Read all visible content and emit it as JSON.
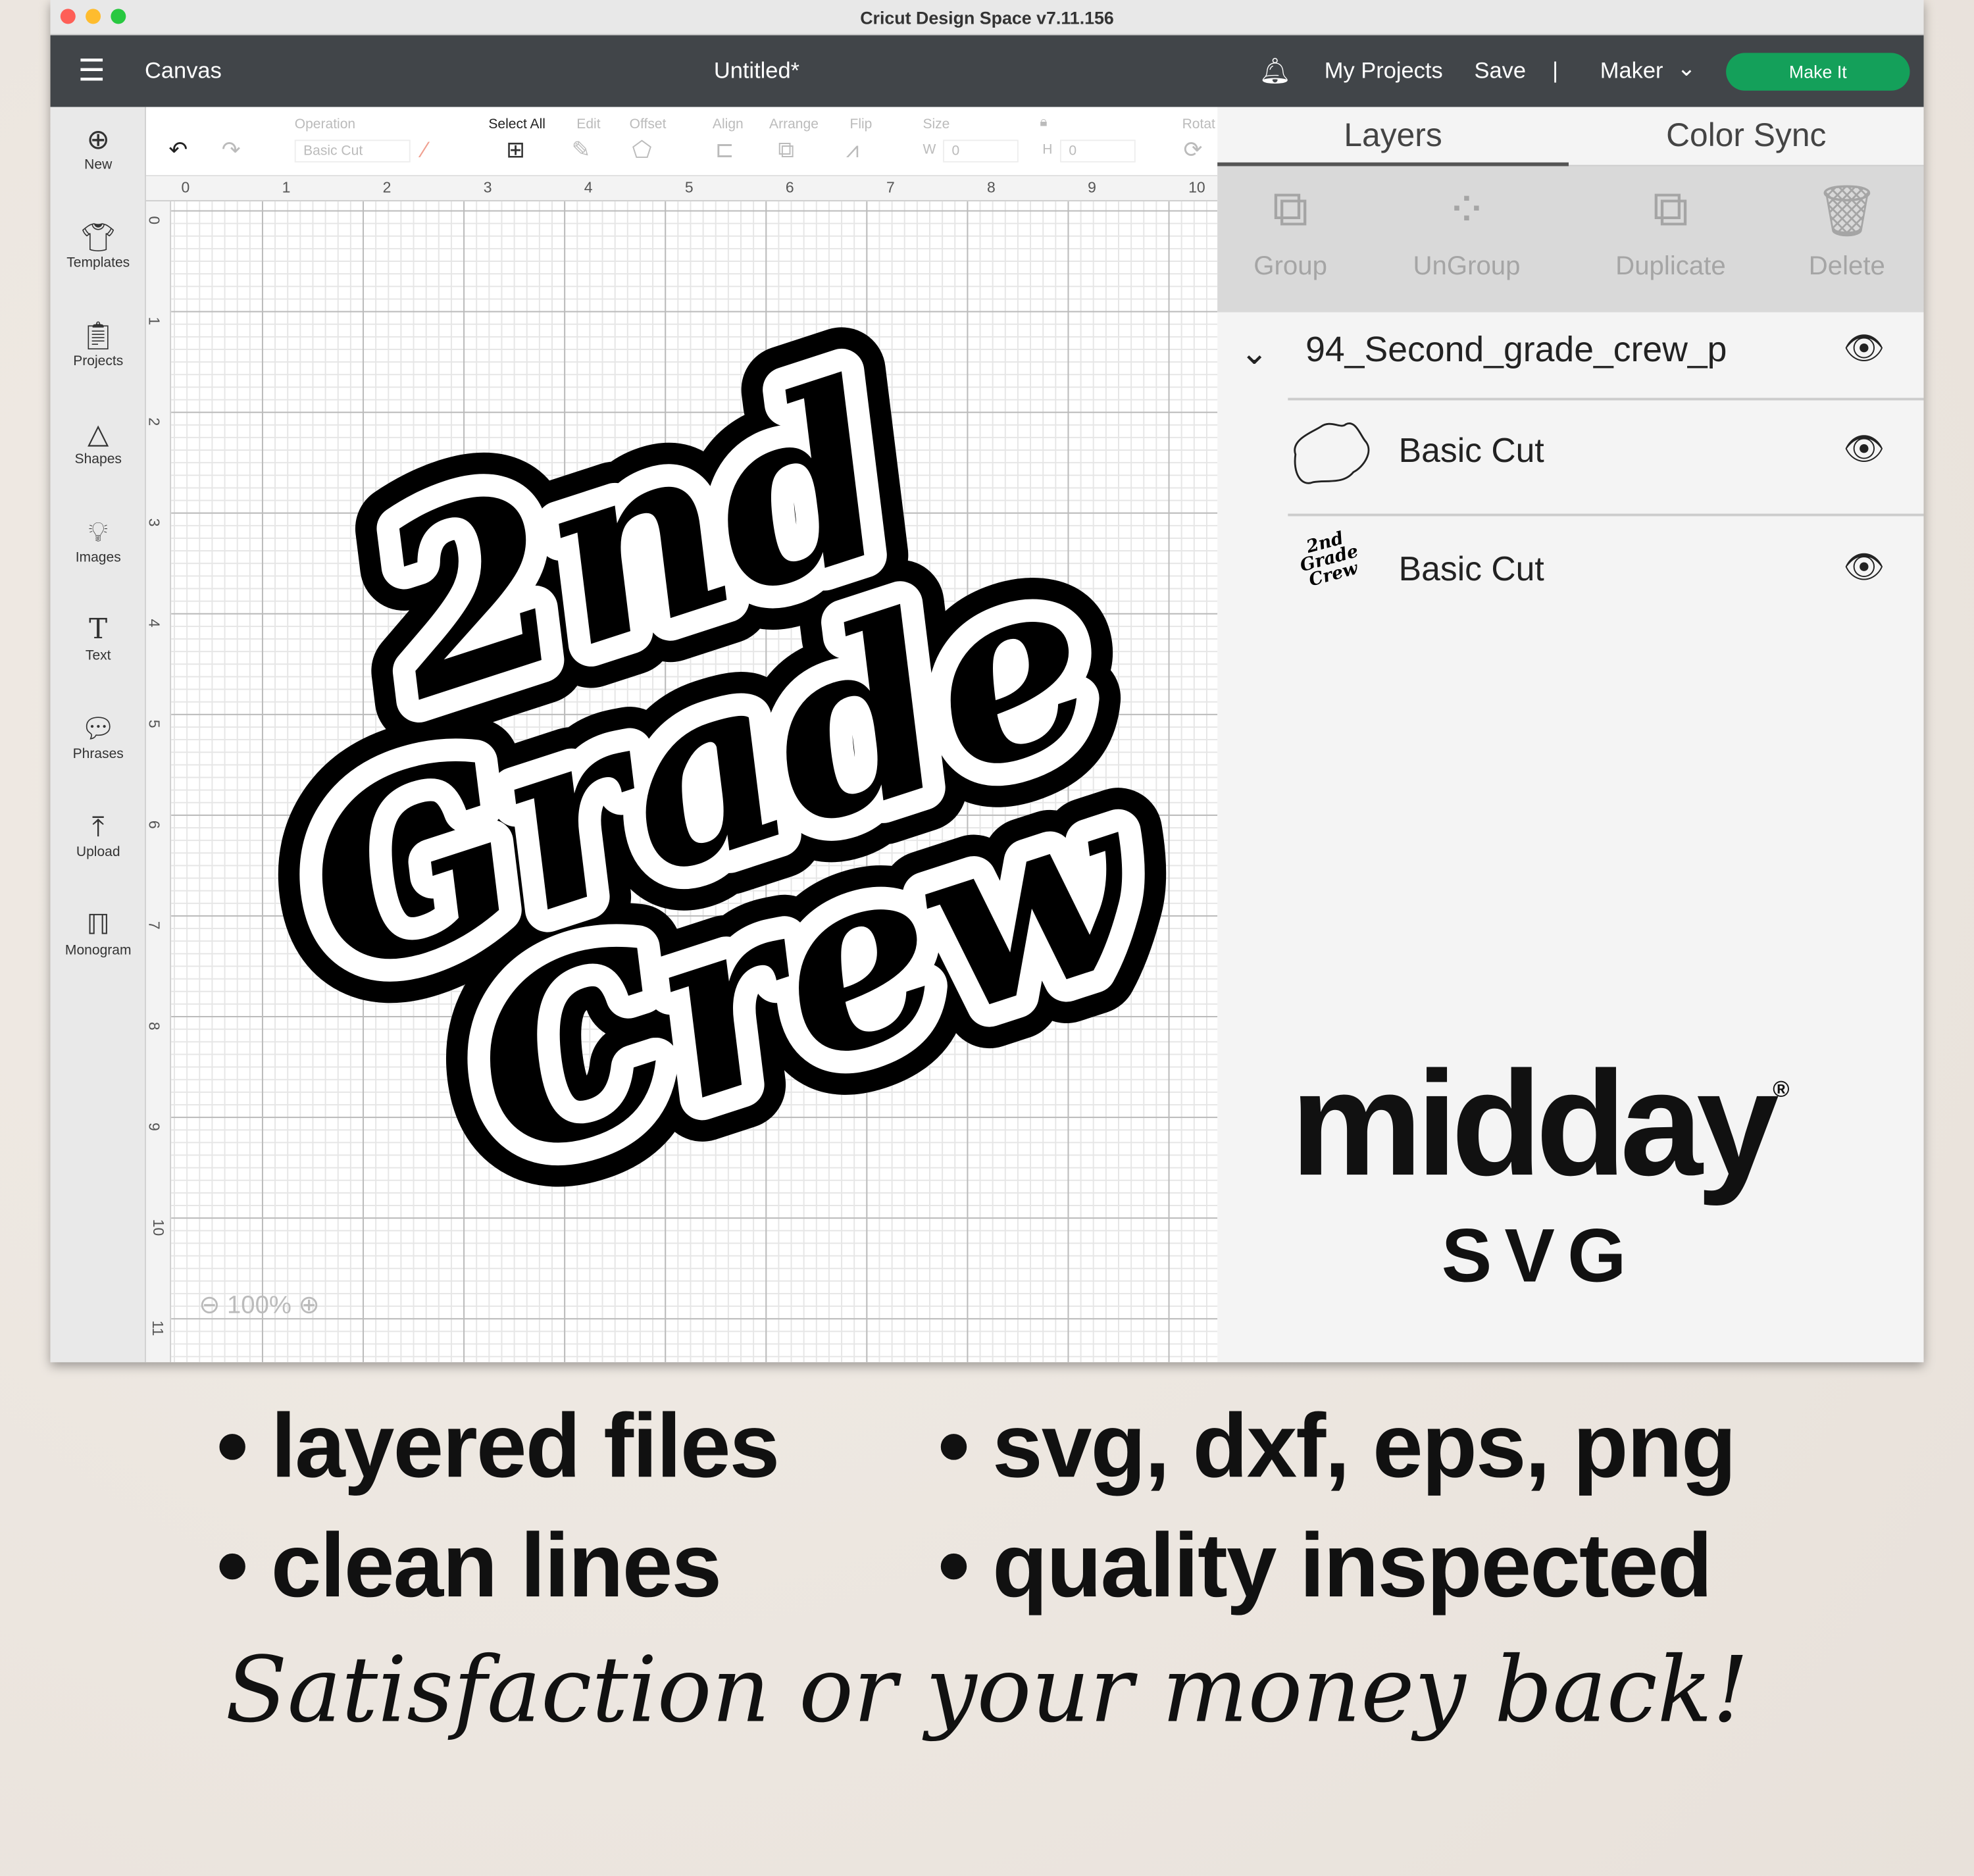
{
  "window": {
    "title": "Cricut Design Space  v7.11.156"
  },
  "header": {
    "menu_icon": "hamburger-icon",
    "canvas_label": "Canvas",
    "doc_title": "Untitled*",
    "bell_icon": "bell-icon",
    "my_projects": "My Projects",
    "save": "Save",
    "separator": "|",
    "machine": "Maker",
    "make_it": "Make It",
    "accent": "#14a05a"
  },
  "sidebar": {
    "items": [
      {
        "label": "New",
        "icon": "plus-circle-icon"
      },
      {
        "label": "Templates",
        "icon": "shirt-icon"
      },
      {
        "label": "Projects",
        "icon": "clipboard-icon"
      },
      {
        "label": "Shapes",
        "icon": "shapes-icon"
      },
      {
        "label": "Images",
        "icon": "lightbulb-icon"
      },
      {
        "label": "Text",
        "icon": "text-icon"
      },
      {
        "label": "Phrases",
        "icon": "speech-bubble-icon"
      },
      {
        "label": "Upload",
        "icon": "upload-icon"
      },
      {
        "label": "Monogram",
        "icon": "monogram-icon"
      }
    ]
  },
  "toolbar": {
    "operation_label": "Operation",
    "operation_value": "Basic Cut",
    "select_all": "Select All",
    "edit": "Edit",
    "offset": "Offset",
    "align": "Align",
    "arrange": "Arrange",
    "flip": "Flip",
    "size": "Size",
    "w_label": "W",
    "w_value": "0",
    "h_label": "H",
    "h_value": "0",
    "rotate": "Rotat"
  },
  "ruler": {
    "h": [
      "0",
      "1",
      "2",
      "3",
      "4",
      "5",
      "6",
      "7",
      "8",
      "9",
      "10"
    ],
    "v": [
      "0",
      "1",
      "2",
      "3",
      "4",
      "5",
      "6",
      "7",
      "8",
      "9",
      "10",
      "11"
    ]
  },
  "canvas": {
    "zoom": "100%",
    "art_lines": [
      "2nd",
      "Grade",
      "Crew"
    ]
  },
  "panel": {
    "tabs": [
      "Layers",
      "Color Sync"
    ],
    "actions": [
      "Group",
      "UnGroup",
      "Duplicate",
      "Delete"
    ],
    "group_name": "94_Second_grade_crew_p",
    "layers": [
      "Basic Cut",
      "Basic Cut"
    ],
    "thumb_text": "2nd Grade Crew"
  },
  "brand": {
    "name": "midday",
    "registered": "®",
    "sub": "SVG"
  },
  "features": [
    "• layered files",
    "• svg, dxf, eps, png",
    "• clean lines",
    "• quality inspected"
  ],
  "tagline": "Satisfaction or your money back!"
}
